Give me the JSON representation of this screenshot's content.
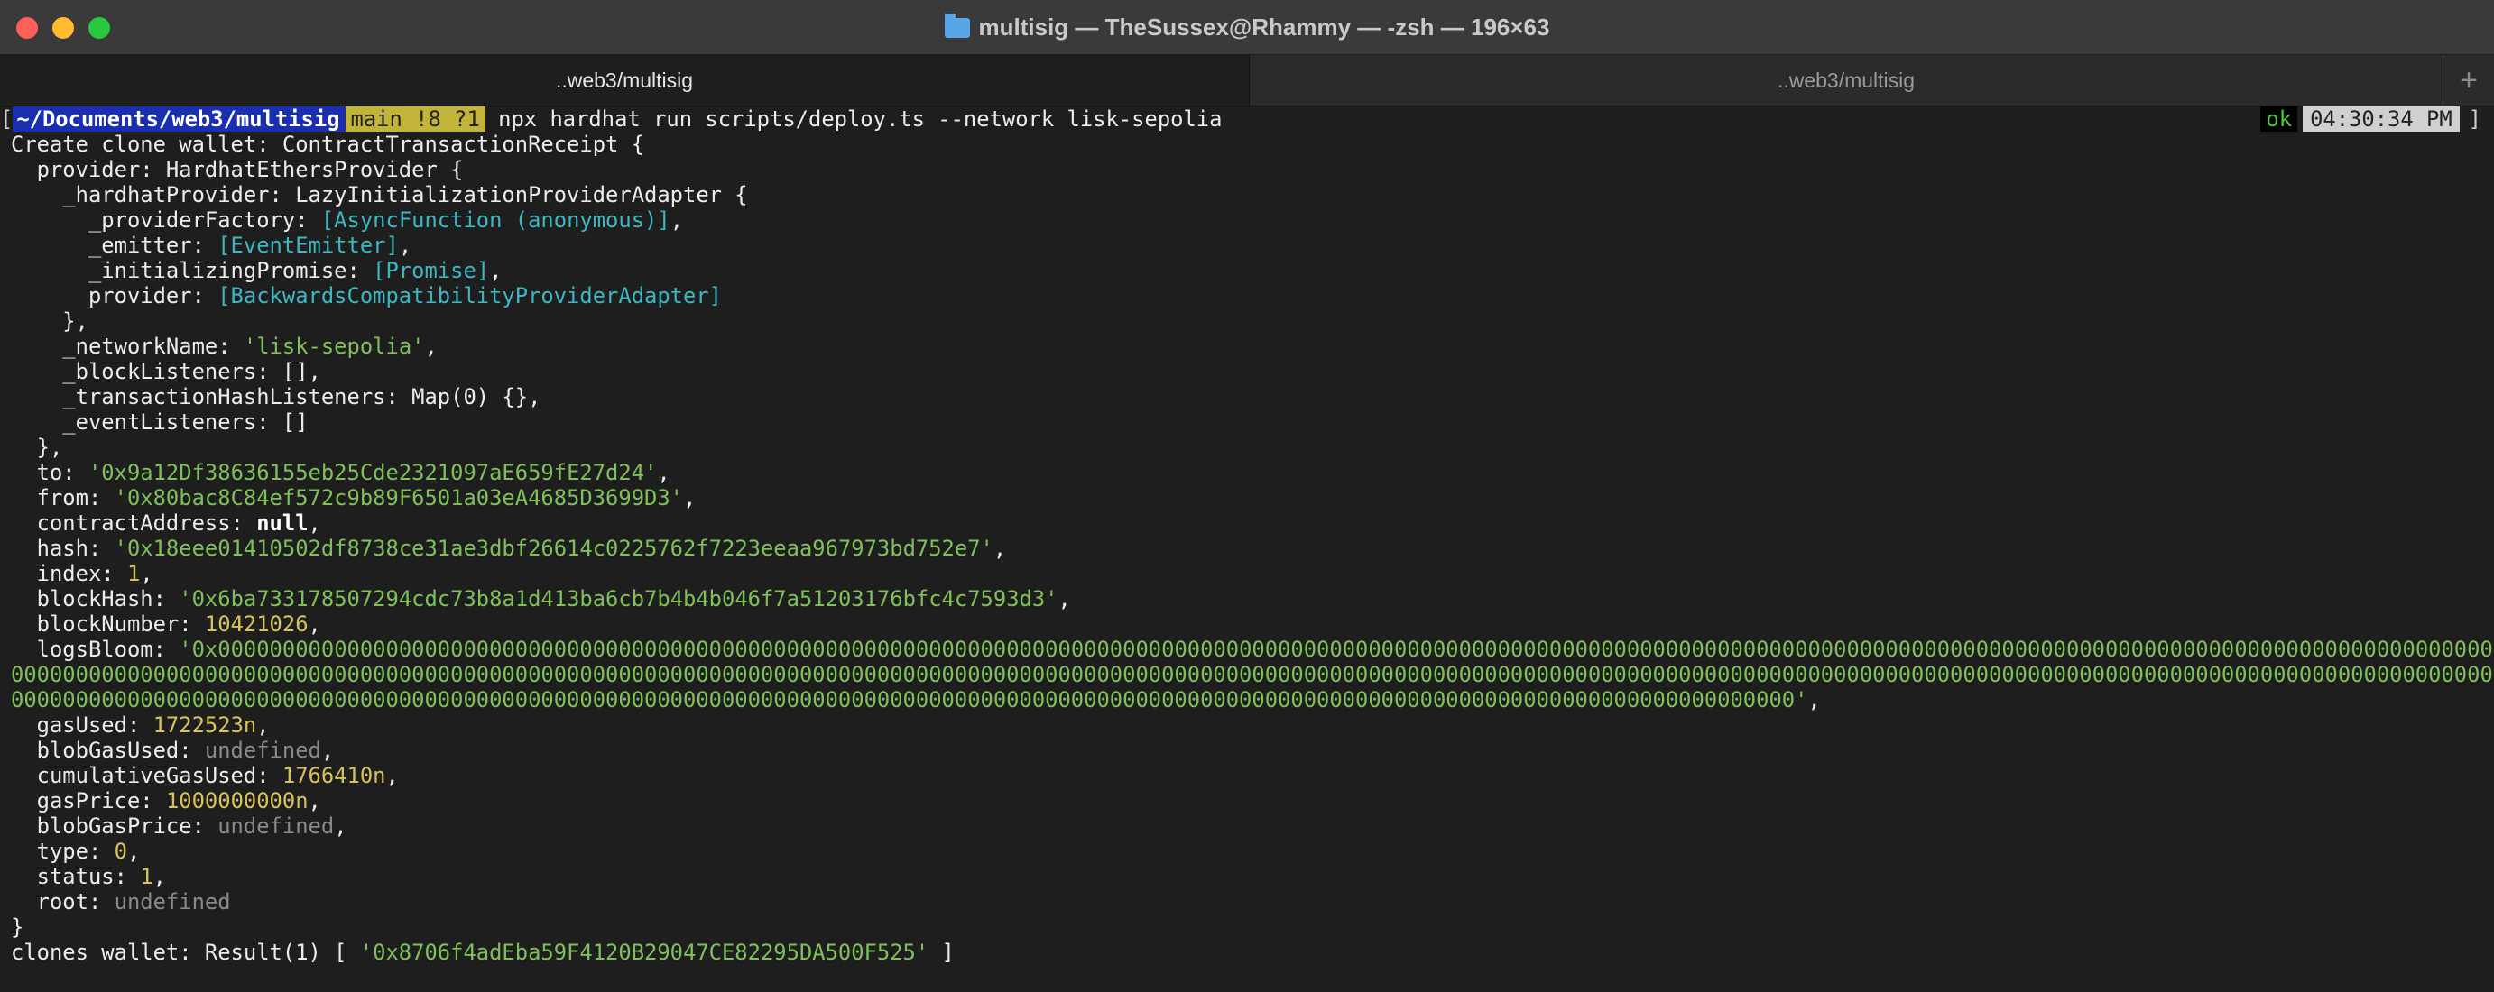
{
  "window": {
    "title": "multisig — TheSussex@Rhammy — -zsh — 196×63"
  },
  "tabs": [
    {
      "label": "..web3/multisig",
      "active": true
    },
    {
      "label": "..web3/multisig",
      "active": false
    }
  ],
  "new_tab_symbol": "+",
  "prompt": {
    "bracket_left": "[",
    "bracket_right": "]",
    "cwd_prefix": "~/Documents/",
    "cwd_bold": "web3/multisig",
    "git_status": "main !8 ?1",
    "command": "npx hardhat run scripts/deploy.ts --network lisk-sepolia",
    "exit_status": "ok",
    "time": "04:30:34 PM"
  },
  "output_lines": [
    [
      {
        "t": "Create clone wallet: ContractTransactionReceipt {"
      }
    ],
    [
      {
        "t": "  provider: HardhatEthersProvider {"
      }
    ],
    [
      {
        "t": "    _hardhatProvider: LazyInitializationProviderAdapter {"
      }
    ],
    [
      {
        "t": "      _providerFactory: "
      },
      {
        "t": "[AsyncFunction (anonymous)]",
        "c": "cc"
      },
      {
        "t": ","
      }
    ],
    [
      {
        "t": "      _emitter: "
      },
      {
        "t": "[EventEmitter]",
        "c": "cc"
      },
      {
        "t": ","
      }
    ],
    [
      {
        "t": "      _initializingPromise: "
      },
      {
        "t": "[Promise]",
        "c": "cc"
      },
      {
        "t": ","
      }
    ],
    [
      {
        "t": "      provider: "
      },
      {
        "t": "[BackwardsCompatibilityProviderAdapter]",
        "c": "cc"
      }
    ],
    [
      {
        "t": "    },"
      }
    ],
    [
      {
        "t": "    _networkName: "
      },
      {
        "t": "'lisk-sepolia'",
        "c": "cs"
      },
      {
        "t": ","
      }
    ],
    [
      {
        "t": "    _blockListeners: [],"
      }
    ],
    [
      {
        "t": "    _transactionHashListeners: Map(0) {},"
      }
    ],
    [
      {
        "t": "    _eventListeners: []"
      }
    ],
    [
      {
        "t": "  },"
      }
    ],
    [
      {
        "t": "  to: "
      },
      {
        "t": "'0x9a12Df38636155eb25Cde2321097aE659fE27d24'",
        "c": "cs"
      },
      {
        "t": ","
      }
    ],
    [
      {
        "t": "  from: "
      },
      {
        "t": "'0x80bac8C84ef572c9b89F6501a03eA4685D3699D3'",
        "c": "cs"
      },
      {
        "t": ","
      }
    ],
    [
      {
        "t": "  contractAddress: "
      },
      {
        "t": "null",
        "c": "cb"
      },
      {
        "t": ","
      }
    ],
    [
      {
        "t": "  hash: "
      },
      {
        "t": "'0x18eee01410502df8738ce31ae3dbf26614c0225762f7223eeaa967973bd752e7'",
        "c": "cs"
      },
      {
        "t": ","
      }
    ],
    [
      {
        "t": "  index: "
      },
      {
        "t": "1",
        "c": "cn"
      },
      {
        "t": ","
      }
    ],
    [
      {
        "t": "  blockHash: "
      },
      {
        "t": "'0x6ba733178507294cdc73b8a1d413ba6cb7b4b4b046f7a51203176bfc4c7593d3'",
        "c": "cs"
      },
      {
        "t": ","
      }
    ],
    [
      {
        "t": "  blockNumber: "
      },
      {
        "t": "10421026",
        "c": "cn"
      },
      {
        "t": ","
      }
    ],
    [
      {
        "t": "  logsBloom: "
      },
      {
        "t": "'0x0000000000000000000000000000000000000000000000000000000000000000000000000000000000000000000000000000000000000000000000000000000000000000000000000000000000000000000000000000000000",
        "c": "cs"
      }
    ],
    [
      {
        "t": "00000000000000000000000000000000000000000000000000000000000000000000000000000000000000000000000000000000000000000000000000000000000000000000000000000000000000000000000000000000000000000000000000",
        "c": "cs"
      }
    ],
    [
      {
        "t": "000000000000000000000000000000000000000000000000000000000000000000000000000000000000000000000000000000000000000000000000000000000000000000'",
        "c": "cs"
      },
      {
        "t": ","
      }
    ],
    [
      {
        "t": "  gasUsed: "
      },
      {
        "t": "1722523n",
        "c": "cn"
      },
      {
        "t": ","
      }
    ],
    [
      {
        "t": "  blobGasUsed: "
      },
      {
        "t": "undefined",
        "c": "cu"
      },
      {
        "t": ","
      }
    ],
    [
      {
        "t": "  cumulativeGasUsed: "
      },
      {
        "t": "1766410n",
        "c": "cn"
      },
      {
        "t": ","
      }
    ],
    [
      {
        "t": "  gasPrice: "
      },
      {
        "t": "1000000000n",
        "c": "cn"
      },
      {
        "t": ","
      }
    ],
    [
      {
        "t": "  blobGasPrice: "
      },
      {
        "t": "undefined",
        "c": "cu"
      },
      {
        "t": ","
      }
    ],
    [
      {
        "t": "  type: "
      },
      {
        "t": "0",
        "c": "cn"
      },
      {
        "t": ","
      }
    ],
    [
      {
        "t": "  status: "
      },
      {
        "t": "1",
        "c": "cn"
      },
      {
        "t": ","
      }
    ],
    [
      {
        "t": "  root: "
      },
      {
        "t": "undefined",
        "c": "cu"
      }
    ],
    [
      {
        "t": "}"
      }
    ],
    [
      {
        "t": "clones wallet: Result(1) [ "
      },
      {
        "t": "'0x8706f4adEba59F4120B29047CE82295DA500F525'",
        "c": "cs"
      },
      {
        "t": " ]"
      }
    ]
  ]
}
